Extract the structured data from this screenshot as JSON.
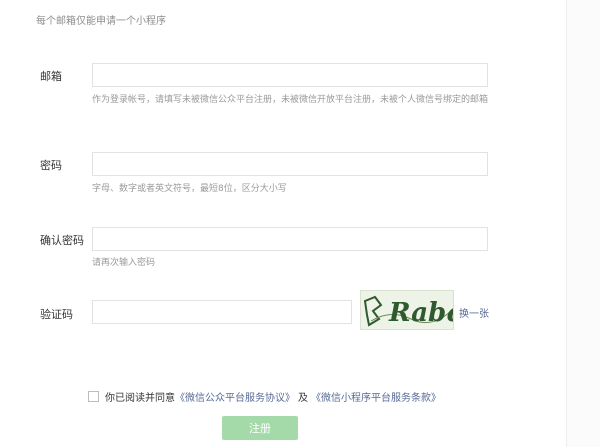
{
  "intro": "每个邮箱仅能申请一个小程序",
  "email": {
    "label": "邮箱",
    "value": "",
    "hint": "作为登录帐号，请填写未被微信公众平台注册，未被微信开放平台注册，未被个人微信号绑定的邮箱"
  },
  "password": {
    "label": "密码",
    "value": "",
    "hint": "字母、数字或者英文符号，最短8位，区分大小写"
  },
  "confirm_password": {
    "label": "确认密码",
    "value": "",
    "hint": "请再次输入密码"
  },
  "captcha": {
    "label": "验证码",
    "value": "",
    "image_text": "Rabq",
    "refresh_label": "换一张"
  },
  "agreement": {
    "checked": false,
    "prefix": "你已阅读并同意",
    "link1": "《微信公众平台服务协议》",
    "conj": "及",
    "link2": "《微信小程序平台服务条款》"
  },
  "submit": {
    "label": "注册"
  },
  "colors": {
    "link": "#576b95",
    "button_bg": "#a4d9a9",
    "hint": "#9a9a9a",
    "border": "#e2e2e2"
  }
}
